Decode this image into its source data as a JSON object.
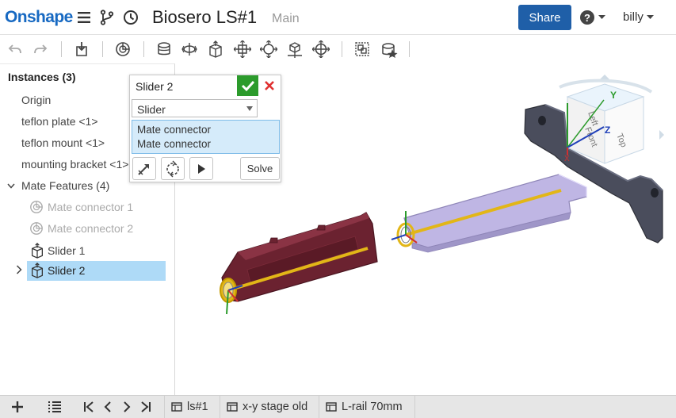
{
  "header": {
    "logo": "Onshape",
    "document_title": "Biosero LS#1",
    "workspace": "Main",
    "share_label": "Share",
    "user": "billy"
  },
  "toolbar": {
    "icons": [
      "undo-icon",
      "redo-icon",
      "insert-icon",
      "mate-connector-icon",
      "fastened-mate-icon",
      "revolute-mate-icon",
      "slider-mate-icon",
      "planar-mate-icon",
      "cylindrical-mate-icon",
      "pin-slot-mate-icon",
      "ball-mate-icon",
      "group-icon",
      "replicate-icon"
    ]
  },
  "instances": {
    "title": "Instances (3)",
    "items": [
      "Origin",
      "teflon plate <1>",
      "teflon mount <1>",
      "mounting bracket <1>"
    ],
    "mate_features_label": "Mate Features (4)",
    "mate_features": [
      "Mate connector 1",
      "Mate connector 2",
      "Slider 1",
      "Slider 2"
    ]
  },
  "dialog": {
    "title": "Slider 2",
    "mate_type": "Slider",
    "selections": [
      "Mate connector",
      "Mate connector"
    ],
    "solve_label": "Solve"
  },
  "view_cube": {
    "faces": [
      "Left",
      "Front",
      "Top"
    ],
    "axes": [
      "X",
      "Y",
      "Z"
    ]
  },
  "bottom_tabs": [
    "ls#1",
    "x-y stage old",
    "L-rail 70mm"
  ],
  "colors": {
    "brand": "#1769c2",
    "share": "#1f5fa8",
    "ok": "#2c9b2c",
    "cancel": "#e03030",
    "selection": "#aedaf7",
    "bracket": "#4a4d5c",
    "rail": "#bfb6e4",
    "plate": "#6b2230",
    "slider_axis": "#e2b617"
  }
}
